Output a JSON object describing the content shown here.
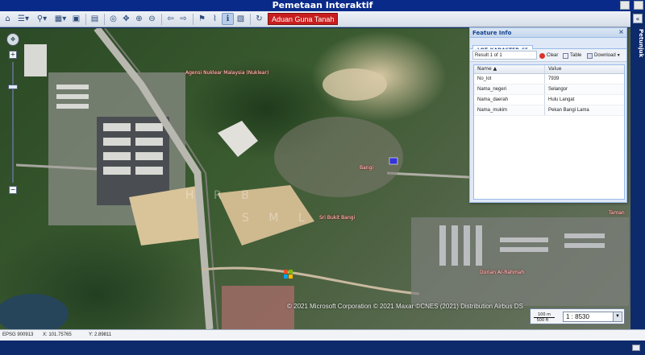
{
  "window": {
    "title": "Pemetaan Interaktif"
  },
  "toolbar": {
    "buttons": [
      "home-icon",
      "layers-icon",
      "zoom-icon",
      "grid-icon",
      "select-icon",
      "save-icon",
      "globe-icon",
      "pan-icon",
      "zoom-in-icon",
      "zoom-out-icon",
      "back-icon",
      "forward-icon",
      "measure-icon",
      "ruler-icon",
      "info-icon",
      "print-icon",
      "refresh-icon"
    ],
    "aduan_label": "Aduan Guna Tanah"
  },
  "sidebar": {
    "label": "Petunjuk"
  },
  "map": {
    "labels": [
      {
        "text": "Agensi Nuklear Malaysia (Nuklear)"
      },
      {
        "text": "Sri Bukit Bangi"
      },
      {
        "text": "Durian Ar-Rahmah"
      },
      {
        "text": "Bangi"
      },
      {
        "text": "Taman"
      }
    ],
    "watermark_top": "H R B",
    "watermark_bottom": "S M L",
    "attribution": "© 2021 Microsoft Corporation © 2021 Maxar ©CNES (2021) Distribution Airbus DS",
    "scale": {
      "value": "1 : 8530",
      "bar_top": "100 m",
      "bar_bottom": "500 ft"
    }
  },
  "feature_info": {
    "title": "Feature Info",
    "tab": "LOT_KADASTER_65",
    "result": "Result 1 of 1",
    "clear_label": "Clear",
    "table_label": "Table",
    "download_label": "Download",
    "columns": [
      "Name",
      "Value"
    ],
    "rows": [
      {
        "name": "No_lot",
        "value": "7939"
      },
      {
        "name": "Nama_negeri",
        "value": "Selangor"
      },
      {
        "name": "Nama_daerah",
        "value": "Hulu Langat"
      },
      {
        "name": "Nama_mukim",
        "value": "Pekan Bangi Lama"
      }
    ]
  },
  "status": {
    "projection": "EPSG 900913",
    "x": "X: 101.75765",
    "y": "Y: 2.89811"
  },
  "colors": {
    "title_bar": "#0a2a8a",
    "aduan_button": "#c81e1e",
    "panel_header": "#15428b"
  }
}
